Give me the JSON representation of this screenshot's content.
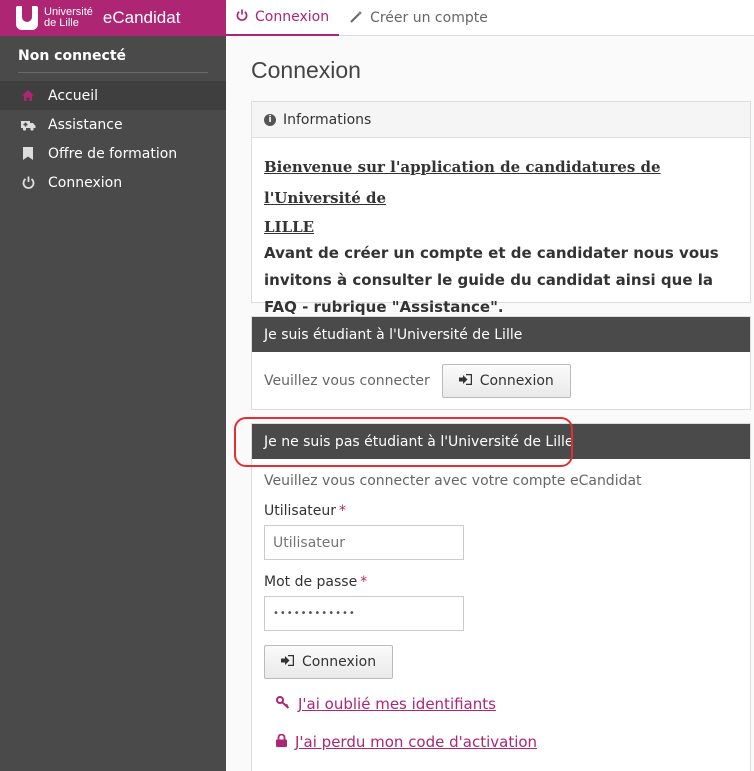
{
  "brand": {
    "logo_text_line1": "Université",
    "logo_text_line2": "de Lille",
    "app_name": "eCandidat"
  },
  "sidebar": {
    "status": "Non connecté",
    "items": [
      {
        "label": "Accueil",
        "icon": "home-icon"
      },
      {
        "label": "Assistance",
        "icon": "ambulance-icon"
      },
      {
        "label": "Offre de formation",
        "icon": "bookmark-icon"
      },
      {
        "label": "Connexion",
        "icon": "power-icon"
      }
    ]
  },
  "tabs": [
    {
      "label": "Connexion",
      "icon": "power-icon"
    },
    {
      "label": "Créer un compte",
      "icon": "magic-wand-icon"
    }
  ],
  "page_title": "Connexion",
  "info_panel": {
    "header": "Informations",
    "title_line1": "Bienvenue sur l'application de candidatures de l'Université de",
    "title_line2": "LILLE",
    "text": "Avant de créer un compte et de candidater nous vous invitons à consulter le guide du candidat ainsi que  la FAQ - rubrique \"Assistance\"."
  },
  "student_panel": {
    "header": "Je suis étudiant à l'Université de Lille",
    "prompt": "Veuillez vous connecter",
    "button": "Connexion"
  },
  "non_student_panel": {
    "header": "Je ne suis pas étudiant à l'Université de Lille",
    "prompt": "Veuillez vous connecter avec votre compte eCandidat",
    "user_label": "Utilisateur",
    "user_placeholder": "Utilisateur",
    "password_label": "Mot de passe",
    "password_value": "••••••••••••",
    "required_mark": "*",
    "button": "Connexion",
    "forgot_link": "J'ai oublié mes identifiants",
    "lost_code_link": "J'ai perdu mon code d'activation"
  },
  "colors": {
    "accent": "#ae2573",
    "sidebar": "#4a4a4a",
    "highlight": "#e03030"
  }
}
